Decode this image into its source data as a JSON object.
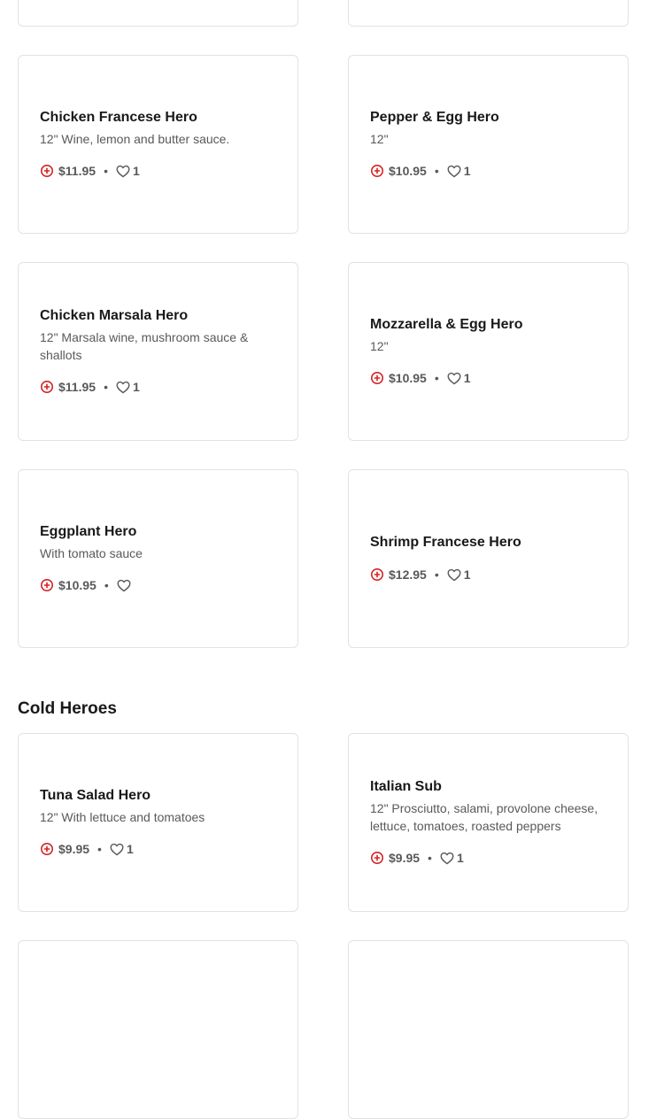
{
  "colors": {
    "accent": "#d32323",
    "card_border": "#e2e2e2",
    "muted_text": "#595959"
  },
  "icons": {
    "add": "plus-circle-icon",
    "like": "heart-icon"
  },
  "hot_items": [
    {
      "name": "Chicken Francese Hero",
      "description": "12\" Wine, lemon and butter sauce.",
      "price": "$11.95",
      "likes": "1"
    },
    {
      "name": "Pepper & Egg Hero",
      "description": "12\"",
      "price": "$10.95",
      "likes": "1"
    },
    {
      "name": "Chicken Marsala Hero",
      "description": "12\" Marsala wine, mushroom sauce & shallots",
      "price": "$11.95",
      "likes": "1"
    },
    {
      "name": "Mozzarella & Egg Hero",
      "description": "12\"",
      "price": "$10.95",
      "likes": "1"
    },
    {
      "name": "Eggplant Hero",
      "description": "With tomato sauce",
      "price": "$10.95",
      "likes": ""
    },
    {
      "name": "Shrimp Francese Hero",
      "description": "",
      "price": "$12.95",
      "likes": "1"
    }
  ],
  "cold_section": {
    "title": "Cold Heroes",
    "items": [
      {
        "name": "Tuna Salad Hero",
        "description": "12\" With lettuce and tomatoes",
        "price": "$9.95",
        "likes": "1"
      },
      {
        "name": "Italian Sub",
        "description": "12\" Prosciutto, salami, provolone cheese, lettuce, tomatoes, roasted peppers",
        "price": "$9.95",
        "likes": "1"
      }
    ]
  }
}
